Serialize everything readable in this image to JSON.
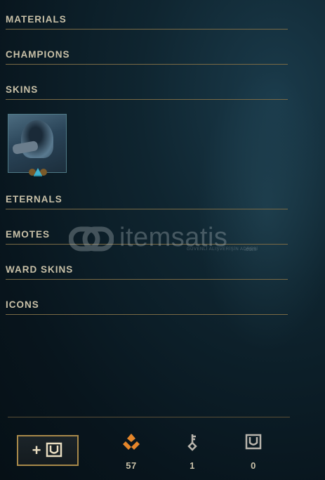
{
  "sections": [
    {
      "label": "MATERIALS"
    },
    {
      "label": "CHAMPIONS"
    },
    {
      "label": "SKINS"
    },
    {
      "label": "ETERNALS"
    },
    {
      "label": "EMOTES"
    },
    {
      "label": "WARD SKINS"
    },
    {
      "label": "ICONS"
    }
  ],
  "skins": {
    "items": [
      {
        "icon": "hooded-champion-skin-icon",
        "badge": "skin-rarity-badge-icon"
      }
    ]
  },
  "watermark": {
    "text": "itemsatis",
    "subtext": "GÜVENLİ ALIŞVERİŞİN ADRESİ",
    "domain": ".com"
  },
  "footer": {
    "add_button": {
      "icon": "loot-key-chest-icon"
    },
    "currencies": [
      {
        "icon": "orange-essence-icon",
        "count": "57",
        "color": "#e5862a"
      },
      {
        "icon": "key-fragment-icon",
        "count": "1",
        "color": "#b8b4ac"
      },
      {
        "icon": "chest-icon",
        "count": "0",
        "color": "#b8b4ac"
      }
    ]
  },
  "colors": {
    "divider": "#7a6a45",
    "text": "#c9c1a8",
    "button_border": "#a8894a"
  }
}
